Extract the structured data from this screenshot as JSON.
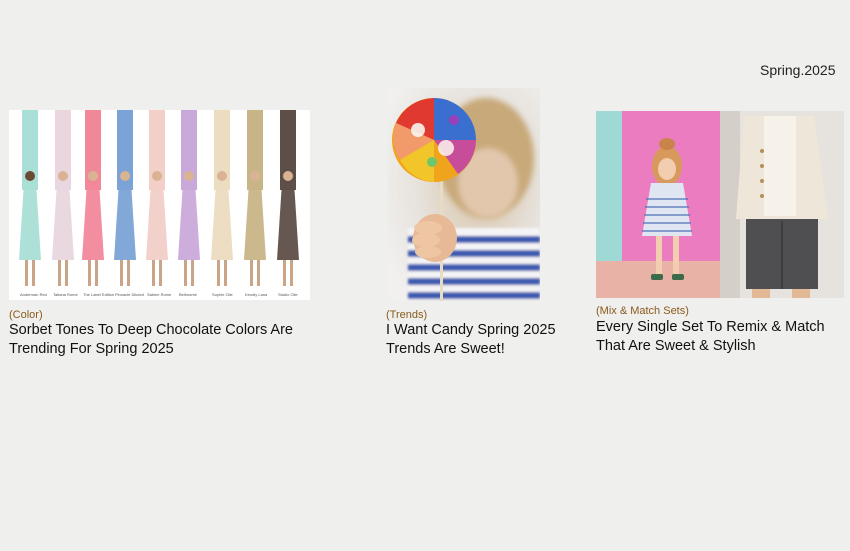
{
  "season": "Spring.2025",
  "articles": [
    {
      "category": "(Color)",
      "title_lines": [
        "Sorbet Tones To Deep Chocolate Colors Are",
        "Trending For Spring 2025"
      ],
      "image_icon": "runway-color-swatches-image",
      "swatch_captions": [
        "Anderman Red",
        "Tatiana Rome",
        "The Label Edition",
        "Pinnacle Diluted",
        "Sabine Rome",
        "Bellmonte",
        "Sophie Olie",
        "Kendly Lana",
        "Studio Olie"
      ]
    },
    {
      "category": "(Trends)",
      "title_lines": [
        "I Want Candy Spring 2025",
        "Trends Are Sweet!"
      ],
      "image_icon": "child-holding-lollipop-image"
    },
    {
      "category": "(Mix & Match Sets)",
      "title_lines": [
        "Every Single Set To Remix & Match",
        "That Are Sweet & Stylish"
      ],
      "image_icon": "kids-fashion-sets-image"
    }
  ],
  "colors": {
    "category": "#8a5a1c",
    "background": "#efefed",
    "swatches": [
      "#a9dfd6",
      "#e9d6df",
      "#f1889a",
      "#7ba3d6",
      "#f2cfc8",
      "#c9a9d9",
      "#ecdcc0",
      "#c9b487",
      "#5e4e48"
    ]
  }
}
